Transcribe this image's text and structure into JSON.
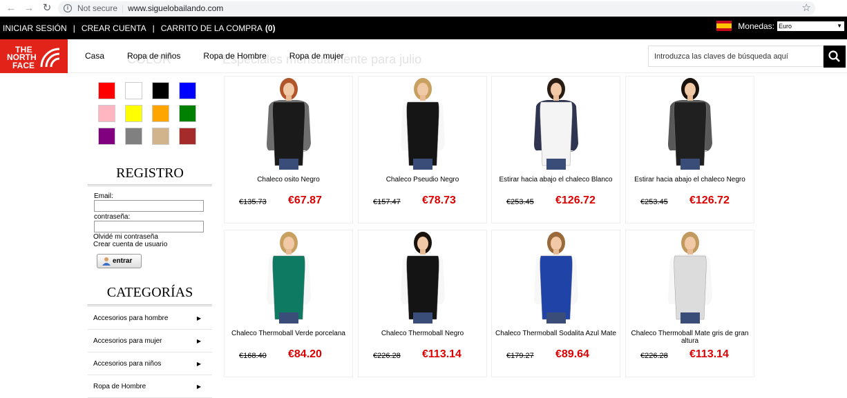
{
  "browser": {
    "security_label": "Not secure",
    "url": "www.siguelobailando.com"
  },
  "topbar": {
    "login": "INICIAR SESIÓN",
    "create_account": "CREAR CUENTA",
    "cart": "CARRITO DE LA COMPRA",
    "cart_count": "(0)",
    "currency_label": "Monedas:",
    "currency_value": "Euro"
  },
  "logo": {
    "line1": "THE",
    "line2": "NORTH",
    "line3": "FACE"
  },
  "nav": [
    "Casa",
    "Ropa de niños",
    "Ropa de Hombre",
    "Ropa de mujer"
  ],
  "search": {
    "placeholder": "Introduzca las claves de búsqueda aquí"
  },
  "ghost": {
    "color_title": "COLOR",
    "banner": "Especiales mensualmente para julio"
  },
  "colors": [
    "#ff0000",
    "#ffffff",
    "#000000",
    "#0000ff",
    "#ffb6c1",
    "#ffff00",
    "#ffa500",
    "#008000",
    "#800080",
    "#808080",
    "#d2b48c",
    "#a52a2a"
  ],
  "register": {
    "title": "REGISTRO",
    "email_label": "Email:",
    "password_label": "contraseña:",
    "forgot": "Olvidé mi contraseña",
    "create": "Crear cuenta de usuario",
    "enter": "entrar"
  },
  "categories": {
    "title": "CATEGORÍAS",
    "items": [
      "Accesorios para hombre",
      "Accesorios para mujer",
      "Accesorios para niños",
      "Ropa de Hombre"
    ]
  },
  "products": [
    {
      "name": "Chaleco osito Negro",
      "old_price": "€135.73",
      "new_price": "€67.87",
      "hair": "#b0562a",
      "vest": "#1a1a1a",
      "sleeve": "#6e6e6e"
    },
    {
      "name": "Chaleco Pseudio Negro",
      "old_price": "€157.47",
      "new_price": "€78.73",
      "hair": "#c8a060",
      "vest": "#151515",
      "sleeve": "#f7f7f7"
    },
    {
      "name": "Estirar hacia abajo el chaleco Blanco",
      "old_price": "€253.45",
      "new_price": "€126.72",
      "hair": "#2a1d14",
      "vest": "#f4f4f4",
      "sleeve": "#2f3550"
    },
    {
      "name": "Estirar hacia abajo el chaleco Negro",
      "old_price": "€253.45",
      "new_price": "€126.72",
      "hair": "#1a120c",
      "vest": "#202020",
      "sleeve": "#595959"
    },
    {
      "name": "Chaleco Thermoball Verde porcelana",
      "old_price": "€168.40",
      "new_price": "€84.20",
      "hair": "#c8a060",
      "vest": "#0f7a62",
      "sleeve": "#f7f7f7"
    },
    {
      "name": "Chaleco Thermoball Negro",
      "old_price": "€226.28",
      "new_price": "€113.14",
      "hair": "#1a120c",
      "vest": "#141414",
      "sleeve": "#f7f7f7"
    },
    {
      "name": "Chaleco Thermoball Sodalita Azul Mate",
      "old_price": "€179.27",
      "new_price": "€89.64",
      "hair": "#9a6a3a",
      "vest": "#2043a8",
      "sleeve": "#f7f7f7"
    },
    {
      "name": "Chaleco Thermoball Mate gris de gran altura",
      "old_price": "€226.28",
      "new_price": "€113.14",
      "hair": "#c29a60",
      "vest": "#dcdcdc",
      "sleeve": "#f7f7f7"
    }
  ]
}
